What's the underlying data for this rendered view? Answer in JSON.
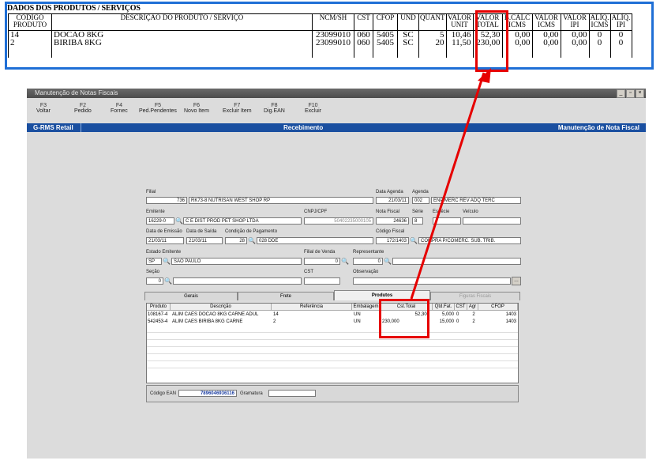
{
  "invoice": {
    "section_title": "DADOS DOS PRODUTOS / SERVIÇOS",
    "headers": {
      "codigo": "CÓDIGO PRODUTO",
      "descricao": "DESCRIÇÃO DO PRODUTO / SERVIÇO",
      "ncm": "NCM/SH",
      "cst": "CST",
      "cfop": "CFOP",
      "und": "UND",
      "quant": "QUANT",
      "valor_unit": "VALOR UNIT",
      "valor_total": "VALOR TOTAL",
      "bcalc": "B.CÁLC ICMS",
      "valor_icms": "VALOR ICMS",
      "valor_ipi": "VALOR IPI",
      "aliq_icms": "ALÍQ. ICMS",
      "aliq_ipi": "ALÍQ. IPI"
    },
    "rows": [
      {
        "codigo": "14",
        "descricao": "DOCAO 8KG",
        "ncm": "23099010",
        "cst": "060",
        "cfop": "5405",
        "und": "SC",
        "quant": "5",
        "valor_unit": "10,46",
        "valor_total": "52,30",
        "bcalc": "0,00",
        "valor_icms": "0,00",
        "valor_ipi": "0,00",
        "aliq_icms": "0",
        "aliq_ipi": "0"
      },
      {
        "codigo": "2",
        "descricao": "BIRIBA 8KG",
        "ncm": "23099010",
        "cst": "060",
        "cfop": "5405",
        "und": "SC",
        "quant": "20",
        "valor_unit": "11,50",
        "valor_total": "230,00",
        "bcalc": "0,00",
        "valor_icms": "0,00",
        "valor_ipi": "0,00",
        "aliq_icms": "0",
        "aliq_ipi": "0"
      }
    ]
  },
  "window": {
    "title": "Manutenção de Notas Fiscais",
    "toolbar": [
      {
        "key": "F3",
        "label": "Voltar"
      },
      {
        "key": "F2",
        "label": "Pedido"
      },
      {
        "key": "F4",
        "label": "Fornec"
      },
      {
        "key": "F5",
        "label": "Ped.Pendentes"
      },
      {
        "key": "F6",
        "label": "Novo Item"
      },
      {
        "key": "F7",
        "label": "Excluir Item"
      },
      {
        "key": "F8",
        "label": "Dig.EAN"
      },
      {
        "key": "F10",
        "label": "Excluir"
      }
    ],
    "bar": {
      "left": "G-RMS Retail",
      "center": "Recebimento",
      "right": "Manutenção de Nota Fiscal"
    }
  },
  "form": {
    "filial_label": "Filial",
    "filial_num": "736",
    "filial_name": "RK73-8 NUTRISAN WEST SHOP RP",
    "data_agenda_label": "Data Agenda",
    "data_agenda": "21/03/11",
    "agenda_label": "Agenda",
    "agenda_num": "002",
    "agenda_text": "ENP MERC REV ADQ TERC",
    "emitente_label": "Emitente",
    "emitente_code": "16229-0",
    "emitente_name": "C E DIST PROD PET SHOP LTDA",
    "cnpj_label": "CNPJ/CPF",
    "cnpj": "50402235000105",
    "nota_label": "Nota Fiscal",
    "nota": "24636",
    "serie_label": "Série",
    "serie": "8",
    "especie_label": "Espécie",
    "veiculo_label": "Veículo",
    "data_emissao_label": "Data de Emissão",
    "data_emissao": "21/03/11",
    "data_saida_label": "Data de Saída",
    "data_saida": "21/03/11",
    "cond_label": "Condição de Pagamento",
    "cond_num": "28",
    "cond_text": "028 DDE",
    "cod_fiscal_label": "Código Fiscal",
    "cod_fiscal": "172/1403",
    "cod_fiscal_text": "COMPRA P/COMERC. SUB. TRIB.",
    "estado_label": "Estado Emitente",
    "estado_uf": "SP",
    "estado_nome": "SAO PAULO",
    "filial_venda_label": "Filial de Venda",
    "filial_venda": "0",
    "representante_label": "Representante",
    "representante": "0",
    "secao_label": "Seção",
    "secao": "0",
    "cst_label": "CST",
    "obs_label": "Observação"
  },
  "tabs": [
    "Gerais",
    "Frete",
    "Produtos",
    "Figuras Fiscais"
  ],
  "grid": {
    "headers": [
      "Produto",
      "Descrição",
      "Referência",
      "Embalagem",
      "Cst.Total",
      "Qtd.Fat.",
      "CST",
      "Agr",
      "CFOP"
    ],
    "rows": [
      [
        "108167-4",
        "ALIM CAES DOCAO 8KG CARNE ADUL",
        "14",
        "UN",
        "52,300",
        "5,000",
        "0",
        "2",
        "1403"
      ],
      [
        "542453-4",
        "ALIM CAES BIRIBA 8KG CARNE",
        "2",
        "UN",
        "230,000",
        "15,000",
        "0",
        "2",
        "1403"
      ]
    ]
  },
  "bottom": {
    "ean_label": "Código EAN",
    "ean": "7896046936116",
    "gramatura_label": "Gramatura"
  },
  "colors": {
    "highlight": "#e60000",
    "invoice_border": "#1f6fd6",
    "app_bar": "#1a4fa0"
  }
}
